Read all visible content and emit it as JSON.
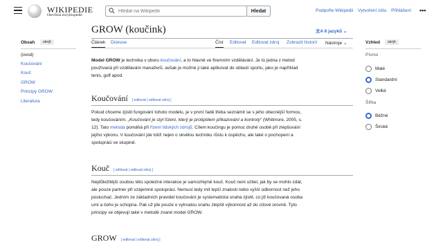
{
  "header": {
    "wordmark": "WIKIPEDIE",
    "tagline": "Otevřená encyklopedie",
    "search_placeholder": "Hledat na Wikipedii",
    "search_button": "Hledat",
    "links": [
      "Podpořte Wikipedii",
      "Vytvoření účtu",
      "Přihlášení"
    ],
    "more": "•••"
  },
  "toc": {
    "title": "Obsah",
    "hide": "skrýt",
    "items": [
      "(úvod)",
      "Koučování",
      "Kouč",
      "GROW",
      "Principy GROW",
      "Literatura"
    ]
  },
  "article": {
    "title": "GROW (koučink)",
    "languages": "6 jazyků",
    "tabs_left": [
      "Článek",
      "Diskuse"
    ],
    "tabs_right": [
      "Číst",
      "Editovat",
      "Editovat zdroj",
      "Zobrazit historii",
      "Nástroje"
    ],
    "intro_l1": " je technika v oboru ",
    "intro_term": "Model GROW",
    "intro_link": "koučování",
    "intro_l1b": ", a to hlavně ve firemním vzdělávání. Je to jedna z metod",
    "intro_l2": "používaná při vzdělávání manažerů, avšak je možné ji také aplikovat do oblastí sportu, jako je například",
    "intro_l3": "tenis, golf apod.",
    "edit_links": "[ editovat | editovat zdroj ]",
    "s1_title": "Koučování",
    "s1_l1": "Pokud chceme zjistit fungování tohoto modelu, je v první řadě třeba seznámit se s jeho obecnější formou,",
    "s1_l2a": "tedy koučováním. ",
    "s1_l2q": "„Koučování je styl řízení, který je protipólem přikazování a kontroly“",
    "s1_l2b": " (Whitmore, 2005, s.",
    "s1_l3a": "12). Tato ",
    "s1_l3link1": "metoda",
    "s1_l3b": " pomáhá při ",
    "s1_l3link2": "řízení lidských zdrojů",
    "s1_l3c": ". Cílem koučingu je pomoc druhé osobě při zlepšování",
    "s1_l4": "jejího výkonu. V koučování jde totiž nejen o skvělou techniku růstu k úspěchu, ale také o pochopení a",
    "s1_l5": "spolupráci ve skupině.",
    "s2_title": "Kouč",
    "s2_l1": "Nejdůležitější osobou této společné interakce je samozřejmě kouč. Kouč není učitel, jak by se mohlo zdát,",
    "s2_l2": "ale pouze partner při vzájemné spolupráci. Nemusí tedy mít lepší znalosti nebo vyšší odbornost než jeho",
    "s2_l3": "posluchač. Jedním ze základních pravidel koučování je systematická snaha zjistit, co již koučovaná osoba",
    "s2_l4": "umí a čeho je schopna. Pak už jde pouze o vytrvalou snahu zlepšit výkonnost až do cílové úrovně. Tyto",
    "s2_l5": "principy se objevují také v metodě zvané model GROW.",
    "s3_title": "GROW"
  },
  "appearance": {
    "title": "Vzhled",
    "hide": "skrýt",
    "text_label": "Písmo",
    "text_options": [
      "Malé",
      "Standardní",
      "Velké"
    ],
    "text_selected": 1,
    "width_label": "Šířka",
    "width_options": [
      "Běžné",
      "Široké"
    ],
    "width_selected": 0
  },
  "colors": {
    "link": "#3366cc",
    "accent_radio": "#3366cc",
    "text": "#202122"
  }
}
